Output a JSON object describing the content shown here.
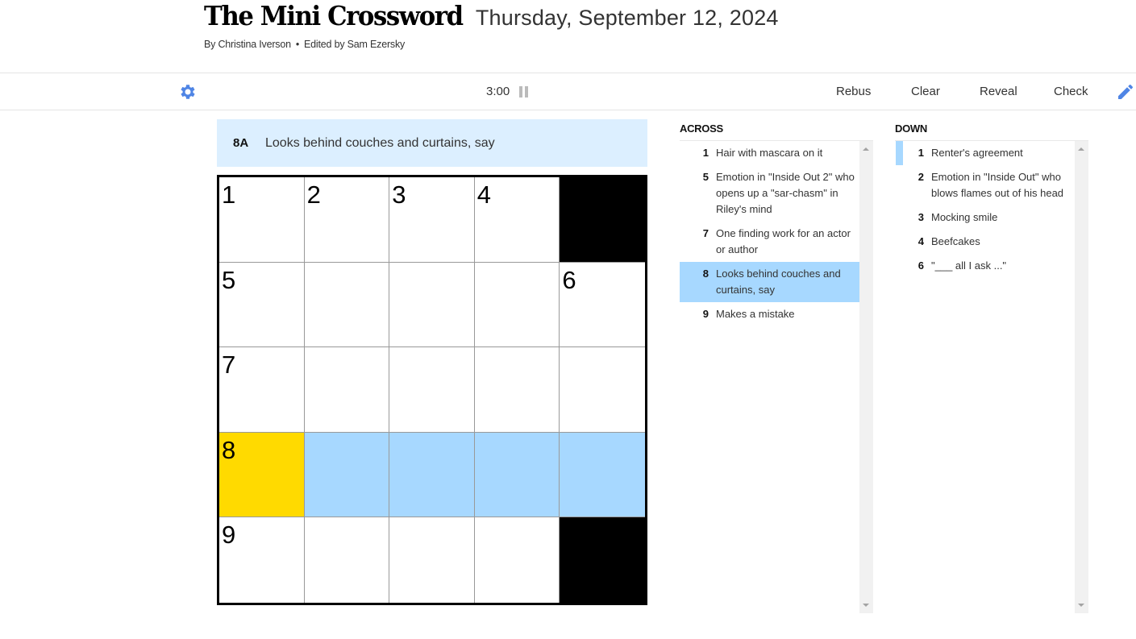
{
  "header": {
    "title": "The Mini Crossword",
    "date": "Thursday, September 12, 2024",
    "author": "By Christina Iverson",
    "separator": "•",
    "editor": "Edited by Sam Ezersky"
  },
  "toolbar": {
    "settings_icon": "gear-icon",
    "timer": "3:00",
    "pause_icon": "pause-icon",
    "rebus": "Rebus",
    "clear": "Clear",
    "reveal": "Reveal",
    "check": "Check",
    "pencil_icon": "pencil-icon"
  },
  "colors": {
    "accent": "#4f85e5",
    "selected_cell": "#ffda00",
    "word_highlight": "#a7d8ff",
    "clue_bar": "#dcefff"
  },
  "current_clue": {
    "label": "8A",
    "text": "Looks behind couches and curtains, say"
  },
  "grid": {
    "rows": 5,
    "cols": 5,
    "cells": [
      [
        {
          "n": "1"
        },
        {
          "n": "2"
        },
        {
          "n": "3"
        },
        {
          "n": "4"
        },
        {
          "black": true
        }
      ],
      [
        {
          "n": "5"
        },
        {},
        {},
        {},
        {
          "n": "6"
        }
      ],
      [
        {
          "n": "7"
        },
        {},
        {},
        {},
        {}
      ],
      [
        {
          "n": "8",
          "state": "selected"
        },
        {
          "state": "word"
        },
        {
          "state": "word"
        },
        {
          "state": "word"
        },
        {
          "state": "word"
        }
      ],
      [
        {
          "n": "9"
        },
        {},
        {},
        {},
        {
          "black": true
        }
      ]
    ]
  },
  "across": {
    "title": "ACROSS",
    "clues": [
      {
        "num": "1",
        "text": "Hair with mascara on it"
      },
      {
        "num": "5",
        "text": "Emotion in \"Inside Out 2\" who opens up a \"sar-chasm\" in Riley's mind"
      },
      {
        "num": "7",
        "text": "One finding work for an actor or author"
      },
      {
        "num": "8",
        "text": "Looks behind couches and curtains, say",
        "active": true
      },
      {
        "num": "9",
        "text": "Makes a mistake"
      }
    ]
  },
  "down": {
    "title": "DOWN",
    "clues": [
      {
        "num": "1",
        "text": "Renter's agreement",
        "related": true
      },
      {
        "num": "2",
        "text": "Emotion in \"Inside Out\" who blows flames out of his head"
      },
      {
        "num": "3",
        "text": "Mocking smile"
      },
      {
        "num": "4",
        "text": "Beefcakes"
      },
      {
        "num": "6",
        "text": "\"___ all I ask ...\""
      }
    ]
  }
}
